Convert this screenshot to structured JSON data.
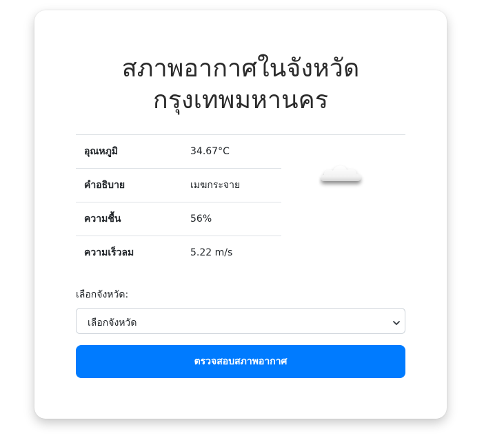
{
  "header": {
    "title_line1": "สภาพอากาศในจังหวัด",
    "title_line2": "กรุงเทพมหานคร"
  },
  "weather": {
    "rows": [
      {
        "label": "อุณหภูมิ",
        "value": "34.67°C"
      },
      {
        "label": "คำอธิบาย",
        "value": "เมฆกระจาย"
      },
      {
        "label": "ความชื้น",
        "value": "56%"
      },
      {
        "label": "ความเร็วลม",
        "value": "5.22 m/s"
      }
    ],
    "icon": "scattered-clouds-icon"
  },
  "form": {
    "select_label": "เลือกจังหวัด:",
    "select_value": "เลือกจังหวัด",
    "submit_label": "ตรวจสอบสภาพอากาศ"
  },
  "colors": {
    "primary_button": "#007bff",
    "divider": "#dee2e6"
  }
}
